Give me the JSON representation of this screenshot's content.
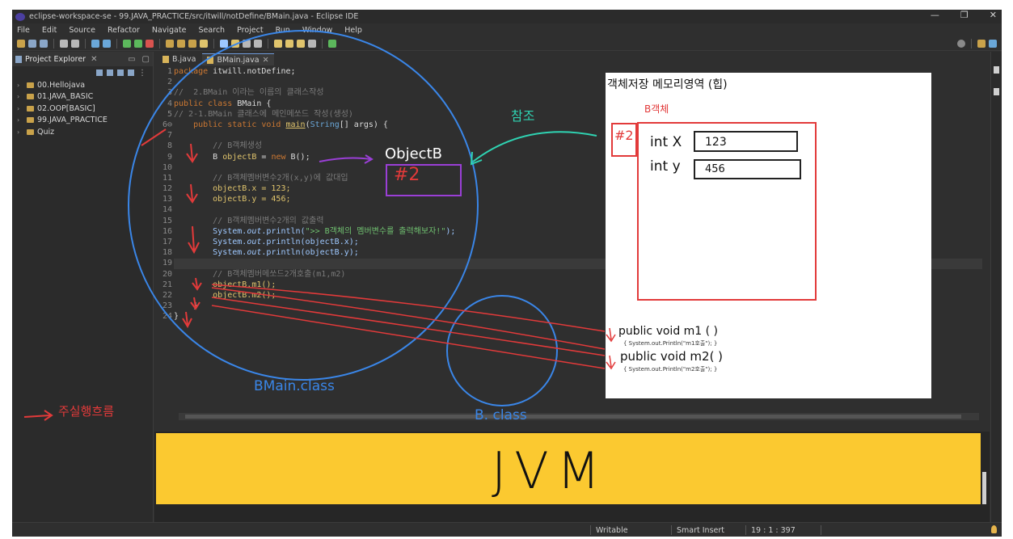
{
  "window": {
    "title": "eclipse-workspace-se - 99.JAVA_PRACTICE/src/itwill/notDefine/BMain.java - Eclipse IDE",
    "controls": [
      "—",
      "❐",
      "✕"
    ]
  },
  "menu": [
    "File",
    "Edit",
    "Source",
    "Refactor",
    "Navigate",
    "Search",
    "Project",
    "Run",
    "Window",
    "Help"
  ],
  "explorer": {
    "title": "Project Explorer",
    "projects": [
      "00.Hellojava",
      "01.JAVA_BASIC",
      "02.OOP[BASIC]",
      "99.JAVA_PRACTICE",
      "Quiz"
    ]
  },
  "editor": {
    "tabs": [
      "B.java",
      "BMain.java"
    ],
    "line_numbers": [
      "1",
      "2",
      "3",
      "4",
      "5",
      "6⊖",
      "7",
      "8",
      "9",
      "10",
      "11",
      "12",
      "13",
      "14",
      "15",
      "16",
      "17",
      "18",
      "19",
      "20",
      "21",
      "22",
      "23",
      "24"
    ],
    "code": {
      "l1_kw": "package",
      "l1_rest": " itwill.notDefine;",
      "l3": "//  2.BMain 이라는 이름의 클래스작성",
      "l4_kw": "public class",
      "l4_rest": " BMain {",
      "l5": "// 2-1.BMain 클래스에 메인메쏘드 작성(생성)",
      "l6_kw": "    public static void ",
      "l6_fn": "main",
      "l6_p": "(",
      "l6_ty": "String",
      "l6_rest": "[] args) {",
      "l8": "        // B객체생성",
      "l9_a": "        B ",
      "l9_b": "objectB",
      "l9_c": " = ",
      "l9_kw": "new",
      "l9_d": " B();",
      "l11": "        // B객체멤버변수2개(x,y)에 값대입",
      "l12": "        objectB.x = 123;",
      "l13": "        objectB.y = 456;",
      "l15": "        // B객체멤버변수2개의 값출력",
      "l16_a": "        System.",
      "l16_it": "out",
      "l16_b": ".println(",
      "l16_st": "\">> B객체의 멤버변수를 출력해보자!\"",
      "l16_c": ");",
      "l17": "        System.",
      "l17_it": "out",
      "l17_b": ".println(objectB.x);",
      "l18": "        System.",
      "l18_it": "out",
      "l18_b": ".println(objectB.y);",
      "l20": "        // B객체멤버메쏘드2개호출(m1,m2)",
      "l21": "        objectB.m1();",
      "l22": "        objectB.m2();",
      "l23": "    }",
      "l24": "}"
    }
  },
  "status": {
    "writable": "Writable",
    "insert": "Smart Insert",
    "position": "19 : 1 : 397"
  },
  "annotations": {
    "ref_label": "참조",
    "object_label": "ObjectB",
    "address": "#2",
    "bmain_class": "BMain.class",
    "b_class": "B. class",
    "flow_legend": "주실행흐름",
    "jvm": "JVM"
  },
  "memory_board": {
    "title": "객체저장 메모리영역 (힙)",
    "object_caption": "B객체",
    "address": "#2",
    "field_x_label": "int X",
    "field_x_value": "123",
    "field_y_label": "int y",
    "field_y_value": "456",
    "m1_sig": "public void m1 ( )",
    "m1_body": "{ System.out.Println(\"m1호출\"); }",
    "m2_sig": "public void m2( )",
    "m2_body": "{ System.out.Println(\"m2호출\"); }"
  },
  "colors": {
    "ide_bg": "#2f2f2f",
    "annotation_blue": "#3a86e8",
    "annotation_red": "#e23a3a",
    "annotation_purple": "#9a3fd6",
    "annotation_teal": "#2fd3b2",
    "jvm_yellow": "#fbc930"
  }
}
